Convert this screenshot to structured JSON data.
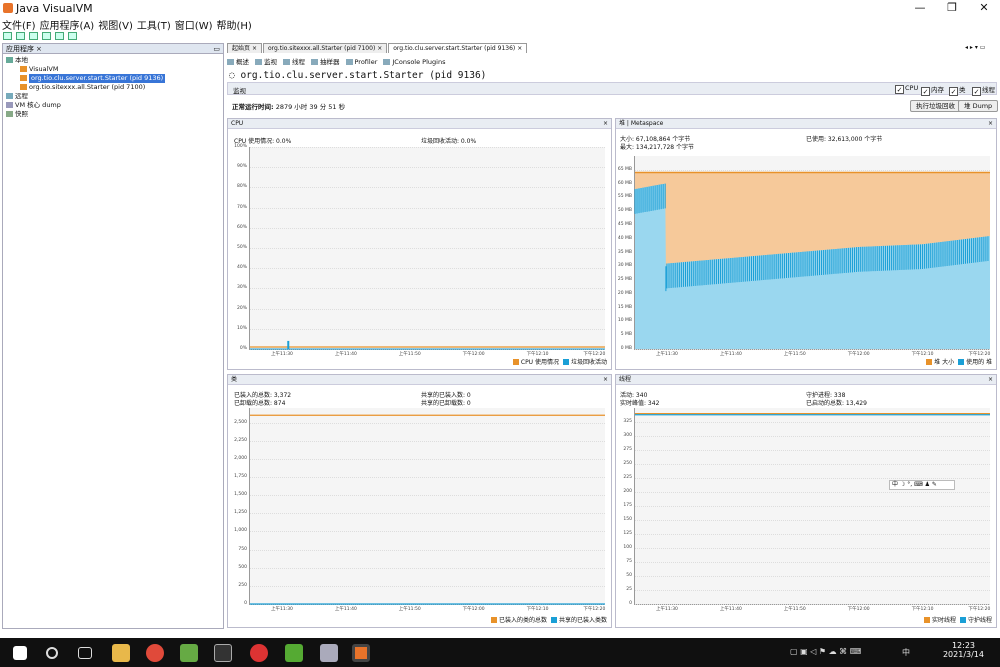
{
  "window": {
    "title": "Java VisualVM",
    "minimize": "—",
    "maximize": "❐",
    "close": "✕"
  },
  "menu": [
    "文件(F)",
    "应用程序(A)",
    "视图(V)",
    "工具(T)",
    "窗口(W)",
    "帮助(H)"
  ],
  "left": {
    "header": "应用程序",
    "header_close": "×",
    "tree": [
      {
        "label": "本地",
        "level": 0
      },
      {
        "label": "VisualVM",
        "level": 1
      },
      {
        "label": "org.tio.clu.server.start.Starter (pid 9136)",
        "level": 1,
        "selected": true
      },
      {
        "label": "org.tio.sitexxx.all.Starter (pid 7100)",
        "level": 1
      },
      {
        "label": "远程",
        "level": 0
      },
      {
        "label": "VM 核心 dump",
        "level": 0
      },
      {
        "label": "快照",
        "level": 0
      }
    ]
  },
  "tabs": [
    {
      "label": "起始页",
      "close": "×"
    },
    {
      "label": "org.tio.sitexxx.all.Starter (pid 7100)",
      "close": "×"
    },
    {
      "label": "org.tio.clu.server.start.Starter (pid 9136)",
      "close": "×",
      "active": true
    }
  ],
  "subtabs": [
    "概述",
    "监视",
    "线程",
    "抽样器",
    "Profiler",
    "JConsole Plugins"
  ],
  "process_title": "org.tio.clu.server.start.Starter (pid 9136)",
  "monitor": {
    "label": "监视",
    "checks": [
      "CPU",
      "内存",
      "类",
      "线程"
    ],
    "uptime_label": "正常运行时间:",
    "uptime": "2879 小时 39 分 51 秒",
    "gc_button": "执行垃圾回收",
    "dump_button": "堆 Dump"
  },
  "cpu_panel": {
    "title": "CPU",
    "close": "×",
    "stat1": "CPU 使用情况: 0.0%",
    "stat2": "垃圾回收活动: 0.0%",
    "legend": [
      "CPU 使用情况",
      "垃圾回收活动"
    ]
  },
  "heap_panel": {
    "title_tab1": "堆",
    "title_tab2": "Metaspace",
    "close": "×",
    "size": "大小: 67,108,864 个字节",
    "used": "已使用: 32,613,000 个字节",
    "max": "最大: 134,217,728 个字节",
    "legend": [
      "堆 大小",
      "使用的 堆"
    ]
  },
  "classes_panel": {
    "title": "类",
    "close": "×",
    "loaded_total": "已装入的总数: 3,372",
    "unloaded_total": "已卸载的总数: 874",
    "shared_loaded": "共享的已装入数: 0",
    "shared_unloaded": "共享的已卸载数: 0",
    "legend": [
      "已装入的类的总数",
      "共享的已装入类数"
    ]
  },
  "threads_panel": {
    "title": "线程",
    "close": "×",
    "live": "活动: 340",
    "live_peak": "实时峰值: 342",
    "daemon": "守护进程: 338",
    "started_total": "已启动的总数: 13,429",
    "legend": [
      "实时线程",
      "守护线程"
    ]
  },
  "x_ticks": [
    "上午11:30",
    "上午11:40",
    "上午11:50",
    "下午12:00",
    "下午12:10",
    "下午12:20"
  ],
  "ime_bar": "中 ☽ °, ⌨ ♟ ✎",
  "taskbar": {
    "time": "12:23",
    "date": "2021/3/14",
    "ime": "中"
  },
  "colors": {
    "orange": "#e8922a",
    "blue": "#1a9fd6",
    "heap_fill": "#f6c99a",
    "used_fill": "#9ad7ef"
  },
  "chart_data": [
    {
      "type": "area",
      "title": "CPU",
      "x": [
        "上午11:30",
        "上午11:40",
        "上午11:50",
        "下午12:00",
        "下午12:10",
        "下午12:20"
      ],
      "y_ticks": [
        "0%",
        "10%",
        "20%",
        "30%",
        "40%",
        "50%",
        "60%",
        "70%",
        "80%",
        "90%",
        "100%"
      ],
      "ylim": [
        0,
        100
      ],
      "series": [
        {
          "name": "CPU 使用情况",
          "values": [
            1,
            1,
            1,
            1,
            1,
            1
          ]
        },
        {
          "name": "垃圾回收活动",
          "values": [
            0,
            0,
            0,
            0,
            0,
            0
          ]
        }
      ]
    },
    {
      "type": "area",
      "title": "堆",
      "x": [
        "上午11:30",
        "上午11:40",
        "上午11:50",
        "下午12:00",
        "下午12:10",
        "下午12:20"
      ],
      "y_ticks": [
        "0 MB",
        "5 MB",
        "10 MB",
        "15 MB",
        "20 MB",
        "25 MB",
        "30 MB",
        "35 MB",
        "40 MB",
        "45 MB",
        "50 MB",
        "55 MB",
        "60 MB",
        "65 MB"
      ],
      "ylim": [
        0,
        70
      ],
      "series": [
        {
          "name": "堆 大小",
          "values": [
            64,
            64,
            64,
            64,
            64,
            64,
            64
          ]
        },
        {
          "name": "使用的 堆",
          "x": [
            "start",
            "上午11:28",
            "上午11:28",
            "上午11:30",
            "上午11:40",
            "上午11:50",
            "下午12:00",
            "下午12:10",
            "下午12:20"
          ],
          "values": [
            58,
            60,
            30,
            31,
            33,
            35,
            37,
            38,
            41
          ]
        }
      ]
    },
    {
      "type": "line",
      "title": "类",
      "x": [
        "上午11:30",
        "上午11:40",
        "上午11:50",
        "下午12:00",
        "下午12:10",
        "下午12:20"
      ],
      "y_ticks": [
        "0",
        "250",
        "500",
        "750",
        "1,000",
        "1,250",
        "1,500",
        "1,750",
        "2,000",
        "2,250",
        "2,500"
      ],
      "ylim": [
        0,
        2700
      ],
      "series": [
        {
          "name": "已装入的类的总数",
          "values": [
            2600,
            2600,
            2600,
            2600,
            2600,
            2600
          ]
        },
        {
          "name": "共享的已装入类数",
          "values": [
            0,
            0,
            0,
            0,
            0,
            0
          ]
        }
      ]
    },
    {
      "type": "line",
      "title": "线程",
      "x": [
        "上午11:30",
        "上午11:40",
        "上午11:50",
        "下午12:00",
        "下午12:10",
        "下午12:20"
      ],
      "y_ticks": [
        "0",
        "25",
        "50",
        "75",
        "100",
        "125",
        "150",
        "175",
        "200",
        "225",
        "250",
        "275",
        "300",
        "325"
      ],
      "ylim": [
        0,
        350
      ],
      "series": [
        {
          "name": "实时线程",
          "values": [
            340,
            340,
            340,
            340,
            340,
            340
          ]
        },
        {
          "name": "守护线程",
          "values": [
            338,
            338,
            338,
            338,
            338,
            338
          ]
        }
      ]
    }
  ]
}
